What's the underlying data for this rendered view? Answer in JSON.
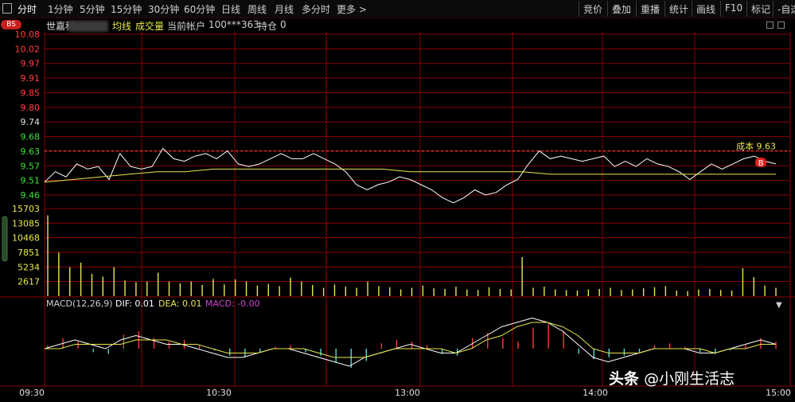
{
  "toolbar": {
    "items": [
      "分时",
      "1分钟",
      "5分钟",
      "15分钟",
      "30分钟",
      "60分钟",
      "日线",
      "周线",
      "月线",
      "多分时",
      "更多 >"
    ],
    "right_items": [
      "竞价",
      "叠加",
      "重播",
      "统计",
      "画线",
      "F10",
      "标记",
      "-自选"
    ]
  },
  "header": {
    "badge": "BS",
    "stock_name": "世嘉科",
    "avg_line_label": "均线",
    "volume_label": "成交量",
    "account_label": "当前帐户",
    "account_value": "100***363",
    "position_label": "持仓",
    "position_value": "0"
  },
  "price_axis": [
    "10.08",
    "10.02",
    "9.97",
    "9.91",
    "9.85",
    "9.80",
    "9.74",
    "9.68",
    "9.63",
    "9.57",
    "9.51",
    "9.46"
  ],
  "volume_axis": [
    "15703",
    "13085",
    "10468",
    "7851",
    "5234",
    "2617"
  ],
  "time_axis": [
    "09:30",
    "10:30",
    "13:00",
    "14:00",
    "15:00"
  ],
  "cost_label": "成本 9.63",
  "trade_marker": "B",
  "macd": {
    "title": "MACD(12,26,9)",
    "dif_label": "DIF: 0.01",
    "dea_label": "DEA: 0.01",
    "macd_label": "MACD: -0.00"
  },
  "watermark": {
    "prefix": "头条",
    "handle": "@小刚生活志"
  },
  "colors": {
    "grid": "#8b0000",
    "up": "#ff3b3b",
    "down": "#5fd3d3",
    "price": "#ffffff",
    "avg": "#e8e850",
    "dea": "#e8e850"
  },
  "chart_data": [
    {
      "type": "line",
      "title": "",
      "x": [
        "09:30",
        "10:30",
        "13:00",
        "14:00",
        "15:00"
      ],
      "ylim": [
        9.46,
        10.08
      ],
      "series": [
        {
          "values": [
            9.51,
            9.55,
            9.53,
            9.58,
            9.56,
            9.57,
            9.52,
            9.62,
            9.57,
            9.56,
            9.57,
            9.64,
            9.6,
            9.59,
            9.61,
            9.62,
            9.6,
            9.63,
            9.58,
            9.57,
            9.58,
            9.6,
            9.62,
            9.6,
            9.6,
            9.62,
            9.6,
            9.58,
            9.55,
            9.5,
            9.48,
            9.5,
            9.51,
            9.53,
            9.52,
            9.5,
            9.48,
            9.45,
            9.43,
            9.45,
            9.48,
            9.46,
            9.47,
            9.5,
            9.52,
            9.58,
            9.63,
            9.6,
            9.61,
            9.6,
            9.59,
            9.6,
            9.61,
            9.57,
            9.59,
            9.57,
            9.6,
            9.58,
            9.57,
            9.55,
            9.52,
            9.55,
            9.58,
            9.56,
            9.58,
            9.6,
            9.61,
            9.59,
            9.58
          ]
        },
        {
          "values": [
            9.51,
            9.52,
            9.53,
            9.54,
            9.55,
            9.55,
            9.56,
            9.56,
            9.56,
            9.56,
            9.56,
            9.56,
            9.56,
            9.55,
            9.55,
            9.55,
            9.55,
            9.55,
            9.54,
            9.54,
            9.54,
            9.54,
            9.54,
            9.54,
            9.54,
            9.54,
            9.54
          ]
        }
      ]
    },
    {
      "type": "bar",
      "title": "",
      "ylim": [
        0,
        15703
      ],
      "values": [
        14500,
        7800,
        5200,
        6000,
        4000,
        3500,
        5200,
        2800,
        2500,
        2617,
        4200,
        2600,
        2300,
        2617,
        2000,
        3100,
        2100,
        3000,
        2617,
        1900,
        2200,
        1800,
        3300,
        2617,
        2000,
        1500,
        2100,
        1700,
        1500,
        2617,
        1800,
        1600,
        1200,
        1500,
        1900,
        1400,
        1300,
        1700,
        1200,
        1100,
        1600,
        1300,
        1200,
        7000,
        1500,
        1700,
        1200,
        1100,
        1000,
        1200,
        1300,
        1500,
        1100,
        1200,
        1400,
        1600,
        1800,
        1000,
        900,
        1200,
        1300,
        1100,
        1000,
        5000,
        3400,
        1900,
        1500
      ]
    },
    {
      "type": "bar",
      "title": "",
      "series": [
        {
          "name": "MACD",
          "values": [
            0.002,
            0.006,
            0.004,
            -0.002,
            -0.003,
            0.008,
            0.01,
            0.006,
            0.004,
            0.005,
            0.002,
            -0.001,
            -0.004,
            -0.005,
            -0.002,
            0.001,
            0.002,
            -0.002,
            -0.004,
            -0.008,
            -0.011,
            -0.007,
            0.003,
            0.005,
            0.004,
            0.002,
            -0.003,
            -0.004,
            0.006,
            0.009,
            0.006,
            0.004,
            0.012,
            0.014,
            0.01,
            -0.003,
            -0.006,
            -0.005,
            -0.004,
            -0.002,
            0.002,
            0.003,
            0.001,
            -0.002,
            -0.003,
            -0.001,
            0.002,
            0.006,
            0.004
          ]
        },
        {
          "name": "DIF",
          "values": [
            0.0,
            0.01,
            0.02,
            0.01,
            0.0,
            0.02,
            0.03,
            0.02,
            0.01,
            0.01,
            0.0,
            -0.01,
            -0.02,
            -0.02,
            -0.01,
            0.0,
            0.0,
            -0.01,
            -0.02,
            -0.03,
            -0.04,
            -0.02,
            -0.01,
            0.0,
            0.01,
            0.0,
            -0.01,
            -0.01,
            0.01,
            0.03,
            0.05,
            0.06,
            0.07,
            0.06,
            0.04,
            0.01,
            -0.02,
            -0.03,
            -0.02,
            -0.01,
            0.0,
            0.0,
            0.0,
            -0.01,
            -0.01,
            0.0,
            0.01,
            0.02,
            0.01
          ]
        },
        {
          "name": "DEA",
          "values": [
            0.0,
            0.0,
            0.01,
            0.01,
            0.01,
            0.01,
            0.02,
            0.02,
            0.02,
            0.01,
            0.01,
            0.0,
            -0.01,
            -0.01,
            -0.01,
            0.0,
            0.0,
            0.0,
            -0.01,
            -0.02,
            -0.02,
            -0.02,
            -0.01,
            0.0,
            0.0,
            0.0,
            0.0,
            -0.01,
            0.0,
            0.02,
            0.03,
            0.05,
            0.06,
            0.06,
            0.05,
            0.03,
            0.0,
            -0.01,
            -0.01,
            -0.01,
            0.0,
            0.0,
            0.0,
            0.0,
            -0.01,
            0.0,
            0.0,
            0.01,
            0.01
          ]
        }
      ]
    }
  ]
}
